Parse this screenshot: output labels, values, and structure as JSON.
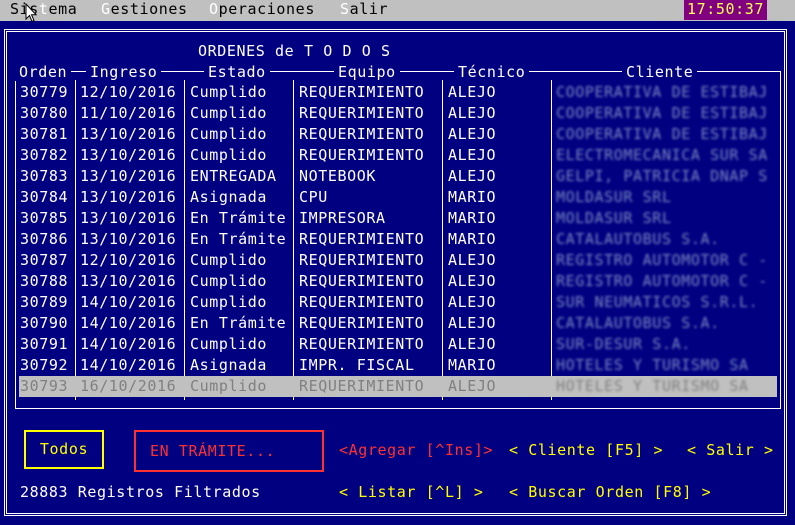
{
  "menu": {
    "items": [
      {
        "first": "S",
        "rest_a": "is",
        "hot": "t",
        "rest_b": "ema"
      },
      {
        "hot": "G",
        "rest": "estiones"
      },
      {
        "hot": "O",
        "rest": "peraciones"
      },
      {
        "hot": "S",
        "rest": "alir"
      }
    ],
    "clock": "17:50:37"
  },
  "title": "ORDENES de T O D O S",
  "columns": [
    "Orden",
    "Ingreso",
    "Estado",
    "Equipo",
    "Técnico",
    "Cliente"
  ],
  "rows": [
    {
      "orden": "30779",
      "ingreso": "12/10/2016",
      "estado": "Cumplido",
      "equipo": "REQUERIMIENTO",
      "tecnico": "ALEJO",
      "cliente": "COOPERATIVA DE ESTIBAJ"
    },
    {
      "orden": "30780",
      "ingreso": "11/10/2016",
      "estado": "Cumplido",
      "equipo": "REQUERIMIENTO",
      "tecnico": "ALEJO",
      "cliente": "COOPERATIVA DE ESTIBAJ"
    },
    {
      "orden": "30781",
      "ingreso": "13/10/2016",
      "estado": "Cumplido",
      "equipo": "REQUERIMIENTO",
      "tecnico": "ALEJO",
      "cliente": "COOPERATIVA DE ESTIBAJ"
    },
    {
      "orden": "30782",
      "ingreso": "13/10/2016",
      "estado": "Cumplido",
      "equipo": "REQUERIMIENTO",
      "tecnico": "ALEJO",
      "cliente": "ELECTROMECANICA SUR SA"
    },
    {
      "orden": "30783",
      "ingreso": "13/10/2016",
      "estado": "ENTREGADA",
      "equipo": "NOTEBOOK",
      "tecnico": "ALEJO",
      "cliente": "GELPI, PATRICIA DNAP S"
    },
    {
      "orden": "30784",
      "ingreso": "13/10/2016",
      "estado": "Asignada",
      "equipo": "CPU",
      "tecnico": "MARIO",
      "cliente": "MOLDASUR SRL"
    },
    {
      "orden": "30785",
      "ingreso": "13/10/2016",
      "estado": "En Trámite",
      "equipo": "IMPRESORA",
      "tecnico": "MARIO",
      "cliente": "MOLDASUR SRL"
    },
    {
      "orden": "30786",
      "ingreso": "13/10/2016",
      "estado": "En Trámite",
      "equipo": "REQUERIMIENTO",
      "tecnico": "MARIO",
      "cliente": "CATALAUTOBUS S.A."
    },
    {
      "orden": "30787",
      "ingreso": "12/10/2016",
      "estado": "Cumplido",
      "equipo": "REQUERIMIENTO",
      "tecnico": "ALEJO",
      "cliente": "REGISTRO AUTOMOTOR C -"
    },
    {
      "orden": "30788",
      "ingreso": "13/10/2016",
      "estado": "Cumplido",
      "equipo": "REQUERIMIENTO",
      "tecnico": "ALEJO",
      "cliente": "REGISTRO AUTOMOTOR C -"
    },
    {
      "orden": "30789",
      "ingreso": "14/10/2016",
      "estado": "Cumplido",
      "equipo": "REQUERIMIENTO",
      "tecnico": "ALEJO",
      "cliente": "SUR NEUMATICOS S.R.L."
    },
    {
      "orden": "30790",
      "ingreso": "14/10/2016",
      "estado": "En Trámite",
      "equipo": "REQUERIMIENTO",
      "tecnico": "ALEJO",
      "cliente": "CATALAUTOBUS S.A."
    },
    {
      "orden": "30791",
      "ingreso": "14/10/2016",
      "estado": "Cumplido",
      "equipo": "REQUERIMIENTO",
      "tecnico": "ALEJO",
      "cliente": "SUR-DESUR S.A."
    },
    {
      "orden": "30792",
      "ingreso": "14/10/2016",
      "estado": "Asignada",
      "equipo": "IMPR. FISCAL",
      "tecnico": "MARIO",
      "cliente": "HOTELES Y TURISMO SA"
    },
    {
      "orden": "30793",
      "ingreso": "16/10/2016",
      "estado": "Cumplido",
      "equipo": "REQUERIMIENTO",
      "tecnico": "ALEJO",
      "cliente": "HOTELES Y TURISMO SA"
    }
  ],
  "selected_row": 14,
  "buttons": {
    "todos": "Todos",
    "en_tramite": "EN TRÁMITE...",
    "agregar": "<Agregar [^Ins]>",
    "cliente": "< Cliente [F5] >",
    "salir": "< Salir >",
    "listar": "< Listar [^L]   >",
    "buscar": "< Buscar Orden [F8] >"
  },
  "status": "28883 Registros Filtrados",
  "colors": {
    "background": "#000080",
    "menubar": "#c0c0c0",
    "highlight": "#ffff00",
    "accent_red": "#ff3030",
    "clock_bg": "#800080"
  }
}
